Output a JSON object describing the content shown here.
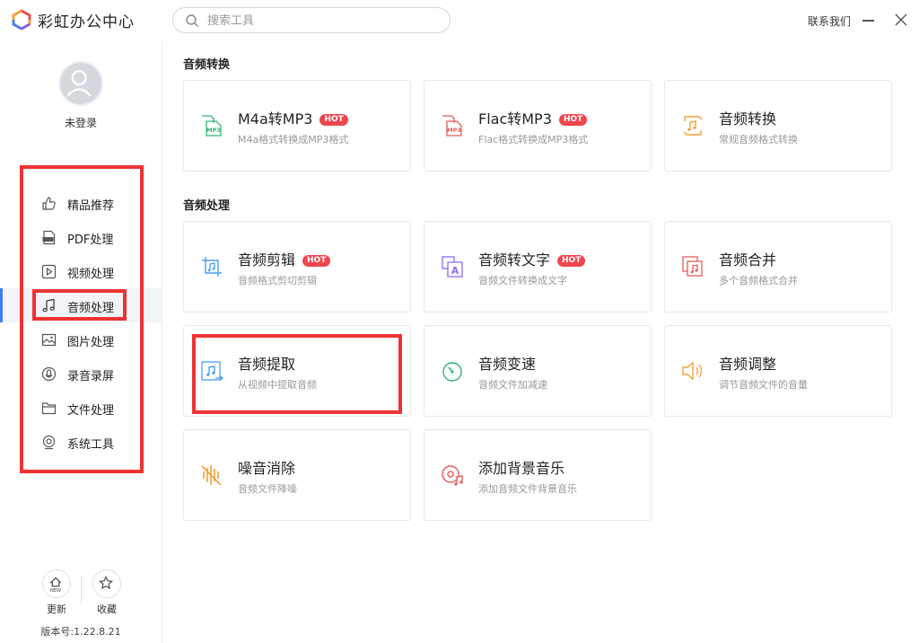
{
  "app": {
    "title": "彩虹办公中心"
  },
  "search": {
    "placeholder": "搜索工具"
  },
  "header": {
    "contact_label": "联系我们"
  },
  "user": {
    "status": "未登录"
  },
  "sidebar": {
    "items": [
      {
        "label": "精品推荐",
        "icon": "thumbs-up-icon"
      },
      {
        "label": "PDF处理",
        "icon": "pdf-icon"
      },
      {
        "label": "视频处理",
        "icon": "video-icon"
      },
      {
        "label": "音频处理",
        "icon": "music-note-icon",
        "active": true
      },
      {
        "label": "图片处理",
        "icon": "image-icon"
      },
      {
        "label": "录音录屏",
        "icon": "record-icon"
      },
      {
        "label": "文件处理",
        "icon": "folder-icon"
      },
      {
        "label": "系统工具",
        "icon": "system-tools-icon"
      }
    ],
    "update_label": "更新",
    "favorite_label": "收藏",
    "new_badge": "NEW",
    "version": "版本号:1.22.8.21"
  },
  "sections": [
    {
      "title": "音频转换",
      "cards": [
        {
          "title": "M4a转MP3",
          "desc": "M4a格式转换成MP3格式",
          "hot": true,
          "icon": "m4a-to-mp3-icon"
        },
        {
          "title": "Flac转MP3",
          "desc": "Flac格式转换成MP3格式",
          "hot": true,
          "icon": "flac-to-mp3-icon"
        },
        {
          "title": "音频转换",
          "desc": "常规音频格式转换",
          "hot": false,
          "icon": "audio-convert-icon"
        }
      ]
    },
    {
      "title": "音频处理",
      "cards": [
        {
          "title": "音频剪辑",
          "desc": "音频格式剪切剪辑",
          "hot": true,
          "icon": "crop-icon"
        },
        {
          "title": "音频转文字",
          "desc": "音频文件转换成文字",
          "hot": true,
          "icon": "audio-to-text-icon"
        },
        {
          "title": "音频合并",
          "desc": "多个音频格式合并",
          "hot": false,
          "icon": "audio-merge-icon"
        },
        {
          "title": "音频提取",
          "desc": "从视频中提取音频",
          "hot": false,
          "icon": "audio-extract-icon"
        },
        {
          "title": "音频变速",
          "desc": "音频文件加减速",
          "hot": false,
          "icon": "speed-icon"
        },
        {
          "title": "音频调整",
          "desc": "调节音频文件的音量",
          "hot": false,
          "icon": "volume-icon"
        },
        {
          "title": "噪音消除",
          "desc": "音频文件降噪",
          "hot": false,
          "icon": "noise-reduction-icon"
        },
        {
          "title": "添加背景音乐",
          "desc": "添加音频文件背景音乐",
          "hot": false,
          "icon": "background-music-icon"
        }
      ]
    }
  ],
  "hot_label": "HOT",
  "mp3_label": "MP3",
  "text_a_label": "A",
  "colors": {
    "accent": "#3d7df5",
    "hot": "#f0464f",
    "highlight": "#ee3333"
  }
}
